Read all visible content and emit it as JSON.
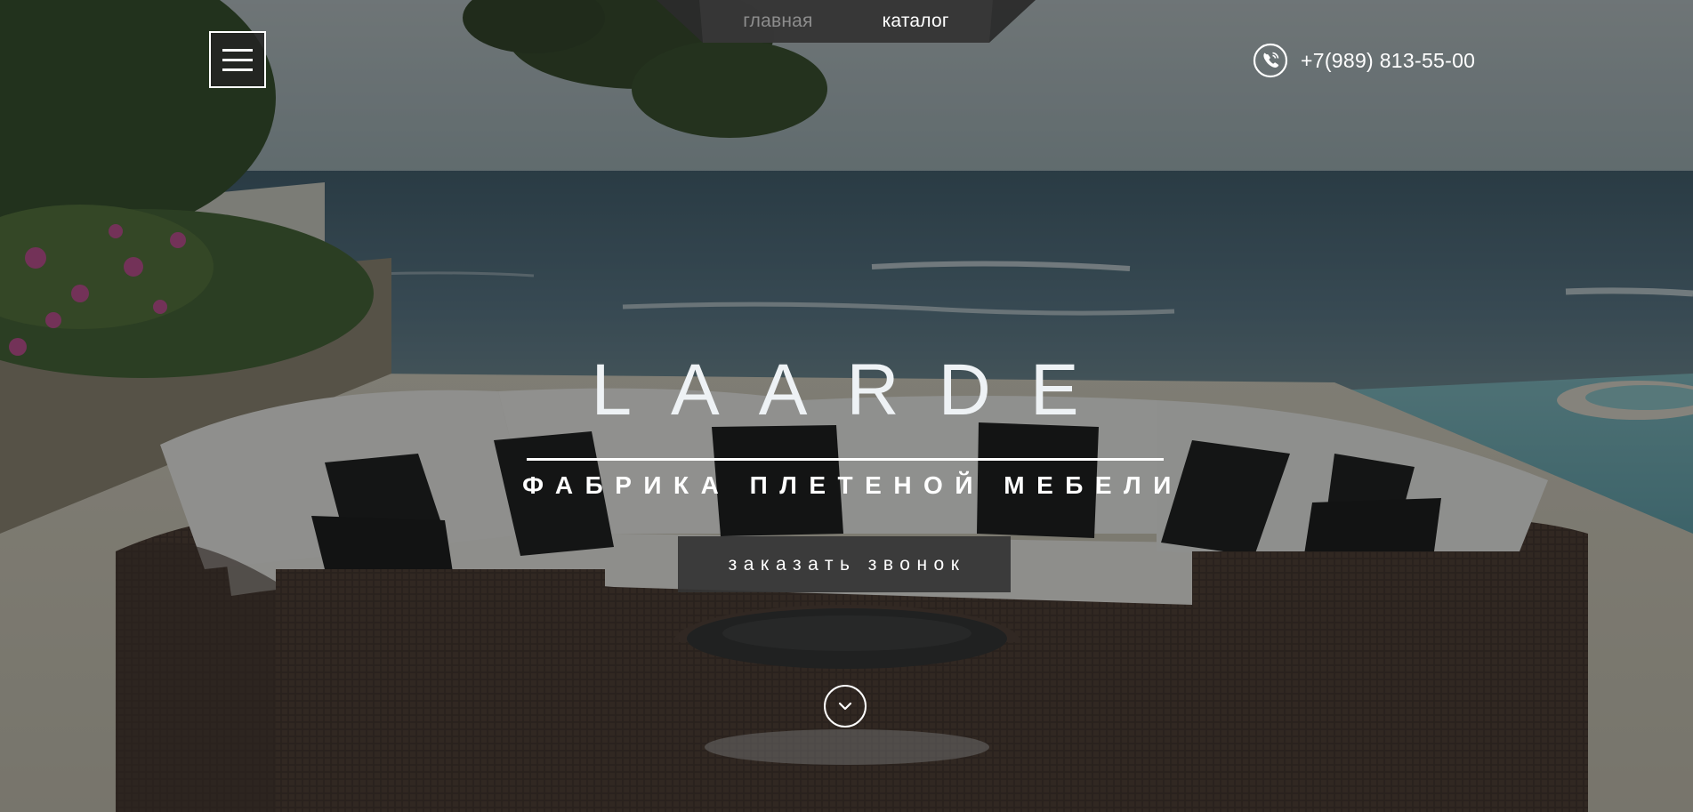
{
  "nav": {
    "items": [
      {
        "label": "главная",
        "active": false
      },
      {
        "label": "каталог",
        "active": true
      }
    ]
  },
  "header": {
    "menu_icon": "hamburger-menu-icon",
    "phone_icon": "phone-icon",
    "phone": "+7(989) 813-55-00"
  },
  "hero": {
    "brand": "LAARDE",
    "subtitle": "ФАБРИКА ПЛЕТЕНОЙ МЕБЕЛИ",
    "cta_label": "заказать звонок",
    "scroll_icon": "chevron-down-icon"
  },
  "colors": {
    "overlay": "#141616",
    "nav_bg": "#2b2b2b",
    "button_bg": "#343434",
    "text_light": "#ffffff",
    "nav_inactive": "#8d8d8d"
  }
}
